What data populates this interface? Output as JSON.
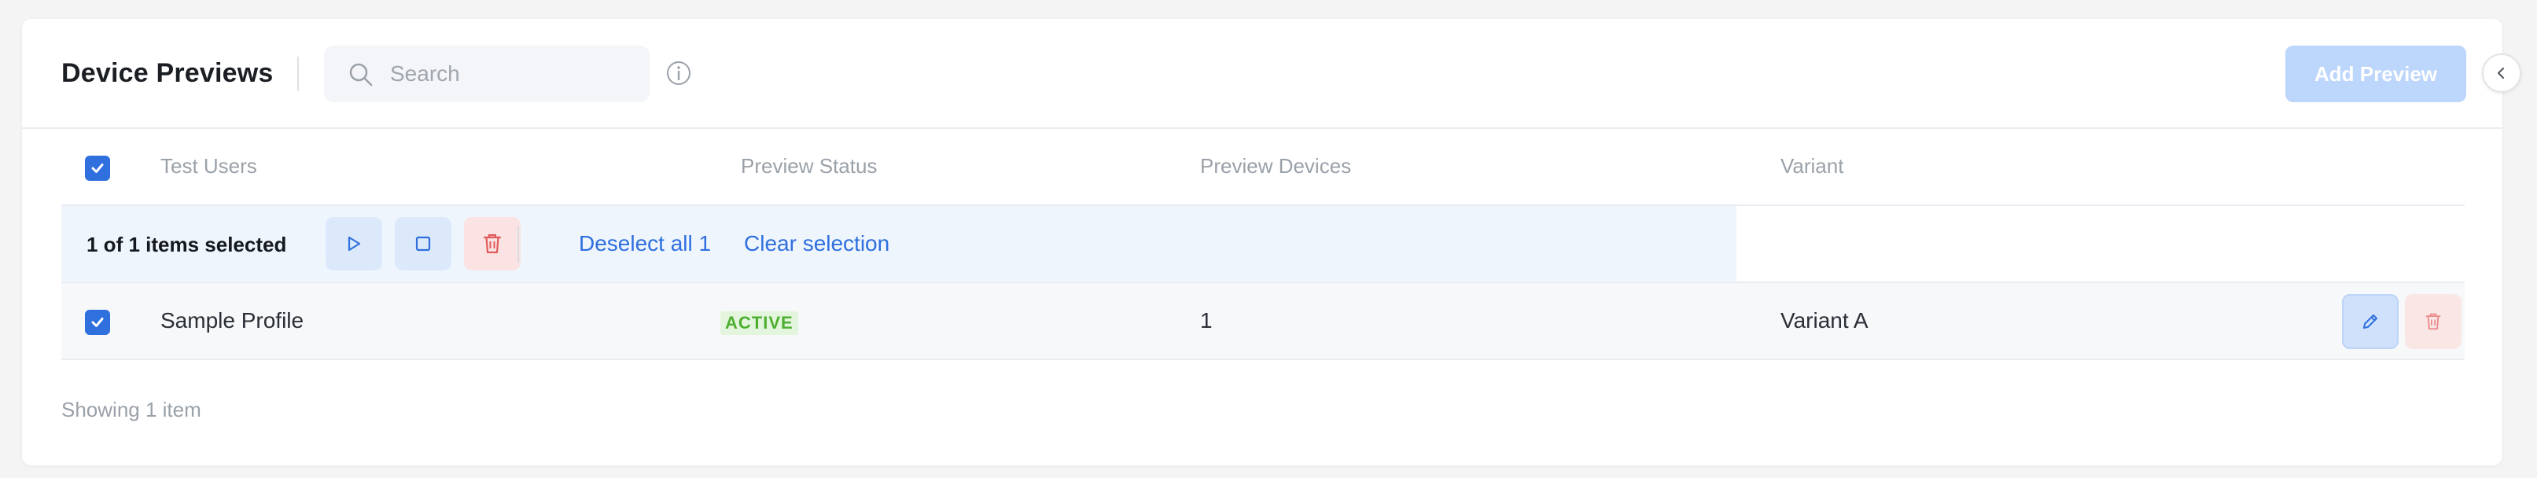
{
  "header": {
    "title": "Device Previews",
    "search_placeholder": "Search",
    "add_button_label": "Add Preview"
  },
  "table": {
    "columns": [
      "Test Users",
      "Preview Status",
      "Preview Devices",
      "Variant"
    ],
    "selection": {
      "count_text": "1 of 1 items selected",
      "deselect_all_label": "Deselect all 1",
      "clear_selection_label": "Clear selection"
    },
    "rows": [
      {
        "test_user": "Sample Profile",
        "status": "ACTIVE",
        "devices": "1",
        "variant": "Variant A",
        "checked": true
      }
    ]
  },
  "footer": {
    "showing_text": "Showing 1 item"
  },
  "colors": {
    "accent": "#2f6fde",
    "status_active": "#4caf2f",
    "danger": "#e05a5a",
    "add_button_bg": "#bdd6fb"
  },
  "icons": {
    "search": "search-icon",
    "info": "info-icon",
    "play": "play-icon",
    "stop": "stop-icon",
    "trash": "trash-icon",
    "edit": "pencil-icon",
    "checkbox": "check-icon",
    "collapse": "chevron-left-icon"
  }
}
